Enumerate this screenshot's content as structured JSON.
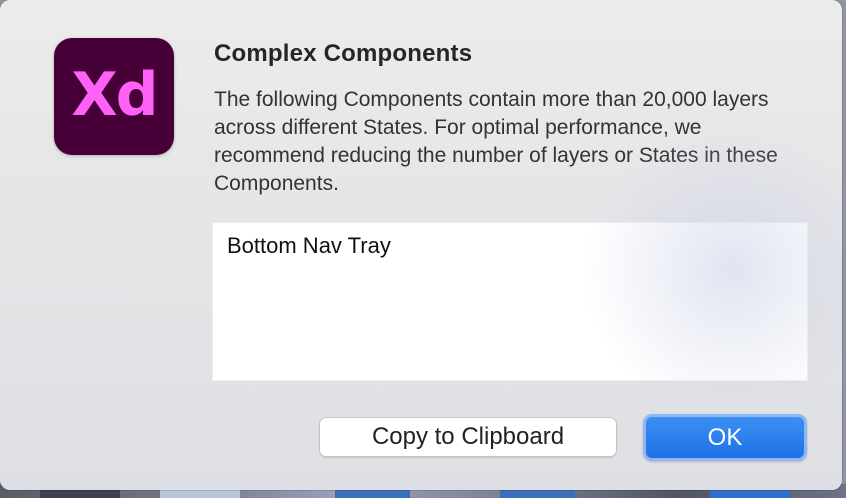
{
  "app": {
    "icon_text": "Xd",
    "icon_colors": {
      "background": "#460037",
      "foreground": "#ff61f6"
    }
  },
  "dialog": {
    "title": "Complex Components",
    "message": "The following Components contain more than 20,000 layers across different States. For optimal performance, we recommend reducing the number of layers or States in these Components.",
    "components": [
      "Bottom Nav Tray"
    ]
  },
  "buttons": {
    "copy_label": "Copy to Clipboard",
    "ok_label": "OK"
  },
  "colors": {
    "accent": "#1e71e6",
    "dialog_bg": "#e8e8ea"
  }
}
